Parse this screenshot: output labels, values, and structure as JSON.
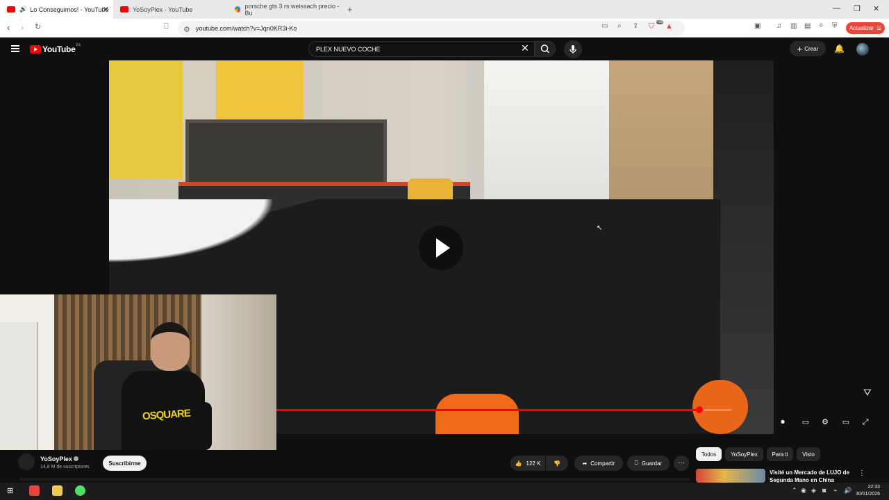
{
  "browser": {
    "tabs": [
      {
        "title": "Lo Conseguimos! - YouTube",
        "active": true
      },
      {
        "title": "YoSoyPlex - YouTube",
        "active": false
      },
      {
        "title": "porsche gts 3 rs weissach precio - Bu",
        "active": false
      }
    ],
    "new_tab_symbol": "+",
    "url": "youtube.com/watch?v=Jqn0KR3i-Ko",
    "update_button": "Actualizar",
    "extension_badge": "+99"
  },
  "youtube": {
    "logo_text": "YouTube",
    "region": "ES",
    "search_value": "PLEX NUEVO COCHE",
    "create_label": "Crear"
  },
  "player": {
    "progress_fraction": 0.93
  },
  "channel": {
    "name": "YoSoyPlex",
    "subscribers": "14,8 M de suscriptores",
    "subscribe_label": "Suscribirme"
  },
  "actions": {
    "likes": "122 K",
    "share_label": "Compartir",
    "save_label": "Guardar",
    "more_symbol": "···"
  },
  "recommend_chips": [
    "Todos",
    "YoSoyPlex",
    "Para ti",
    "Visto"
  ],
  "recommendation": {
    "title": "Visité un Mercado de LUJO de Segunda Mano en China"
  },
  "webcam": {
    "shirt_text": "OSQUARE"
  },
  "taskbar": {
    "time": "22:33",
    "date": "30/01/2026"
  },
  "colors": {
    "accent_red": "#ff0000",
    "update_button": "#e8453c",
    "youtube_bg": "#0f0f0f"
  }
}
